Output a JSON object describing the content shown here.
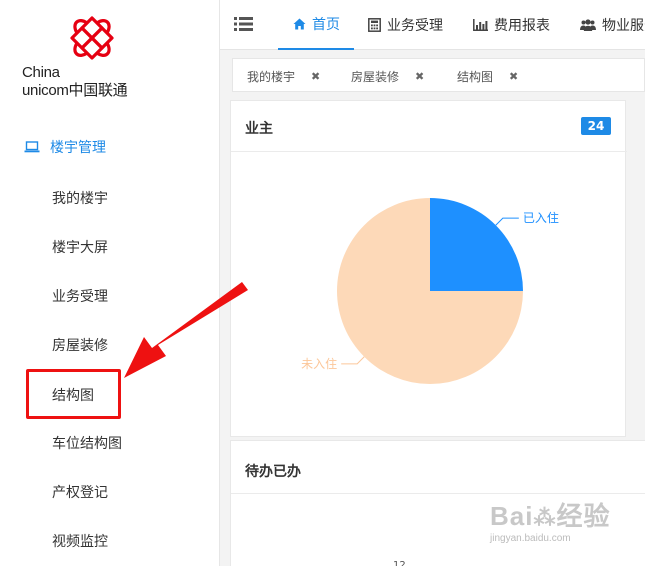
{
  "logo": {
    "line1": "China",
    "line2": "unicom中国联通"
  },
  "sidebar": {
    "group": {
      "label": "楼宇管理",
      "icon": "laptop-icon"
    },
    "items": [
      {
        "label": "我的楼宇"
      },
      {
        "label": "楼宇大屏"
      },
      {
        "label": "业务受理"
      },
      {
        "label": "房屋装修"
      },
      {
        "label": "结构图"
      },
      {
        "label": "车位结构图"
      },
      {
        "label": "产权登记"
      },
      {
        "label": "视频监控"
      }
    ]
  },
  "topnav": {
    "menu_icon": "list-icon",
    "tabs": [
      {
        "label": "首页",
        "icon": "home-icon",
        "active": true
      },
      {
        "label": "业务受理",
        "icon": "calculator-icon",
        "active": false
      },
      {
        "label": "费用报表",
        "icon": "bar-chart-icon",
        "active": false
      },
      {
        "label": "物业服务",
        "icon": "users-icon",
        "active": false
      }
    ]
  },
  "page_tabs": [
    {
      "label": "我的楼宇",
      "close": "✖"
    },
    {
      "label": "房屋装修",
      "close": "✖"
    },
    {
      "label": "结构图",
      "close": "✖"
    }
  ],
  "panels": {
    "owners": {
      "title": "业主",
      "badge": "24"
    },
    "todo": {
      "title": "待办已办",
      "axis_tick": "12"
    }
  },
  "chart_data": {
    "type": "pie",
    "slices": [
      {
        "label": "已入住",
        "value": 25,
        "color": "#1e90ff"
      },
      {
        "label": "未入住",
        "value": 75,
        "color": "#fdd9b8"
      }
    ]
  },
  "watermark": {
    "line1": "Baidu经验",
    "line2": "jingyan.baidu.com"
  },
  "colors": {
    "accent": "#1e8ae6",
    "highlight": "#ee1111",
    "logo_red": "#e60012"
  }
}
